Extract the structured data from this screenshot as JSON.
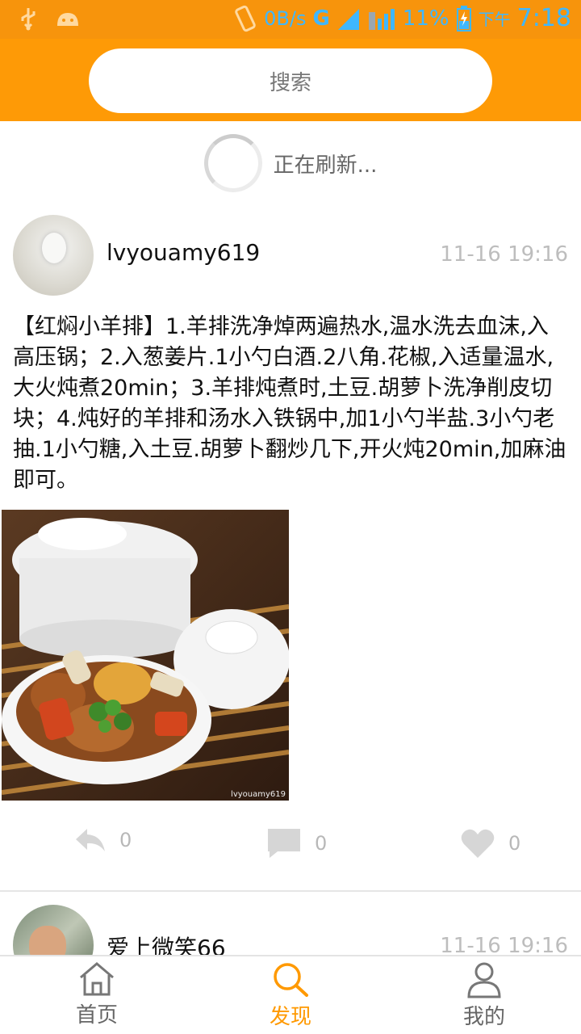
{
  "status_bar": {
    "net_speed": "0B/s",
    "network_type": "G",
    "network_sub": "E",
    "battery": "11%",
    "period": "下午",
    "clock": "7:18",
    "color": "#3fb7ff"
  },
  "header": {
    "search_placeholder": "搜索",
    "background": "#fe9a06"
  },
  "refresh": {
    "text": "正在刷新..."
  },
  "posts": [
    {
      "username": "lvyouamy619",
      "time": "11-16 19:16",
      "content": "【红焖小羊排】1.羊排洗净焯两遍热水,温水洗去血沫,入高压锅；2.入葱姜片.1小勺白酒.2八角.花椒,入适量温水,大火炖煮20min；3.羊排炖煮时,土豆.胡萝卜洗净削皮切块；4.炖好的羊排和汤水入铁锅中,加1小勺半盐.3小勺老抽.1小勺糖,入土豆.胡萝卜翻炒几下,开火炖20min,加麻油即可。",
      "image_watermark": "lvyouamy619",
      "share_count": "0",
      "comment_count": "0",
      "like_count": "0"
    },
    {
      "username": "爱上微笑66",
      "time": "11-16 19:16"
    }
  ],
  "bottom_nav": [
    {
      "label": "首页",
      "icon": "home-icon"
    },
    {
      "label": "发现",
      "icon": "search-icon",
      "active": true
    },
    {
      "label": "我的",
      "icon": "person-icon"
    }
  ],
  "accent_color": "#ff9900"
}
